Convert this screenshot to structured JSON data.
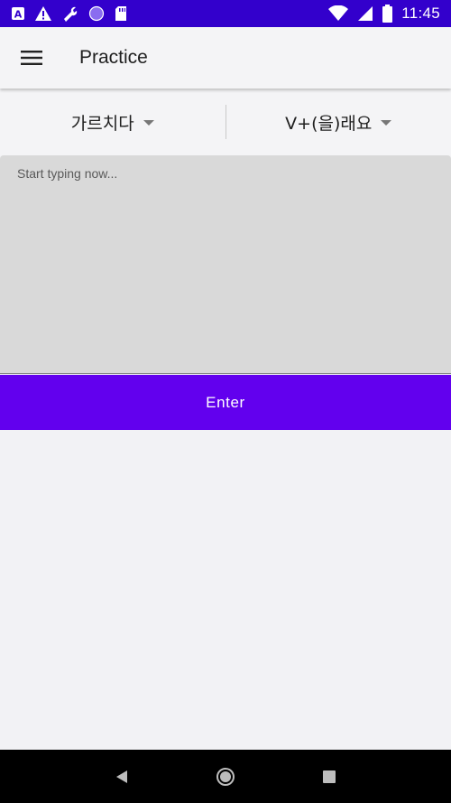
{
  "status_bar": {
    "time": "11:45",
    "left_icons": [
      "notification-a-icon",
      "warning-icon",
      "wrench-icon",
      "circle-icon",
      "sd-card-icon"
    ],
    "right_icons": [
      "wifi-icon",
      "signal-icon",
      "battery-icon"
    ]
  },
  "app_bar": {
    "title": "Practice",
    "menu_icon": "hamburger-menu-icon"
  },
  "selectors": {
    "verb": "가르치다",
    "grammar": "V+(을)래요"
  },
  "input": {
    "value": "",
    "placeholder": "Start typing now..."
  },
  "enter_button": {
    "label": "Enter"
  },
  "nav_bar": {
    "icons": [
      "back-icon",
      "home-icon",
      "recents-icon"
    ]
  },
  "colors": {
    "status_bar": "#3300cc",
    "accent": "#6200ee",
    "input_bg": "#d9d9d9",
    "background": "#f2f2f5"
  }
}
